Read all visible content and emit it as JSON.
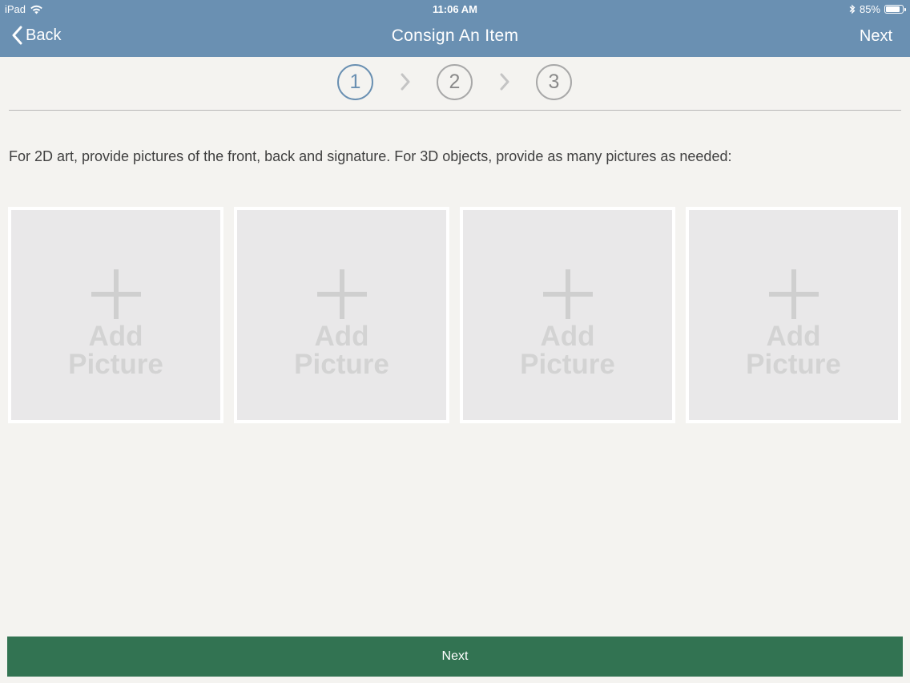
{
  "status_bar": {
    "carrier": "iPad",
    "time": "11:06 AM",
    "battery_percent": "85%",
    "battery_level": 0.85
  },
  "nav": {
    "back_label": "Back",
    "title": "Consign An Item",
    "next_label": "Next"
  },
  "stepper": {
    "steps": [
      "1",
      "2",
      "3"
    ],
    "active_step": 1
  },
  "instructions": "For 2D art, provide pictures of the front, back and signature.  For 3D objects, provide as many pictures as needed:",
  "tiles": [
    {
      "line1": "Add",
      "line2": "Picture"
    },
    {
      "line1": "Add",
      "line2": "Picture"
    },
    {
      "line1": "Add",
      "line2": "Picture"
    },
    {
      "line1": "Add",
      "line2": "Picture"
    }
  ],
  "footer": {
    "next_label": "Next"
  },
  "colors": {
    "nav_bar": "#6a90b2",
    "primary_button": "#327352",
    "background": "#f4f3f0"
  },
  "icons": {
    "back": "chevron-left-icon",
    "wifi": "wifi-icon",
    "bluetooth": "bluetooth-icon",
    "battery": "battery-icon",
    "add": "plus-icon",
    "step_separator": "chevron-right-icon"
  }
}
